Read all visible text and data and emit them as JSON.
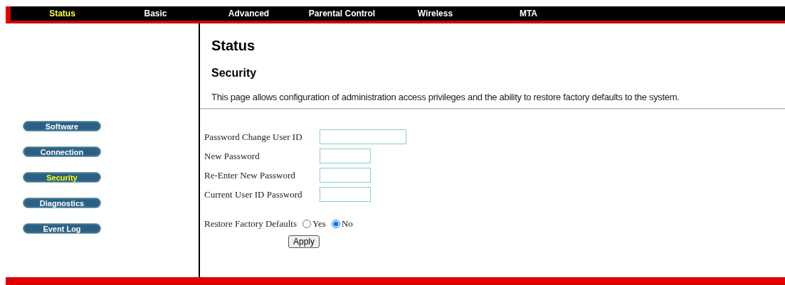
{
  "top_nav": [
    {
      "label": "Status",
      "selected": true
    },
    {
      "label": "Basic",
      "selected": false
    },
    {
      "label": "Advanced",
      "selected": false
    },
    {
      "label": "Parental Control",
      "selected": false
    },
    {
      "label": "Wireless",
      "selected": false
    },
    {
      "label": "MTA",
      "selected": false
    }
  ],
  "sidebar": [
    {
      "label": "Software",
      "selected": false
    },
    {
      "label": "Connection",
      "selected": false
    },
    {
      "label": "Security",
      "selected": true
    },
    {
      "label": "Diagnostics",
      "selected": false
    },
    {
      "label": "Event Log",
      "selected": false
    }
  ],
  "page_title": "Status",
  "section_title": "Security",
  "description": "This page allows configuration of administration access privileges and the ability to restore factory defaults to the system.",
  "fields": [
    {
      "label": "Password Change User ID",
      "kind": "wide"
    },
    {
      "label": "New Password",
      "kind": "short"
    },
    {
      "label": "Re-Enter New Password",
      "kind": "short"
    },
    {
      "label": "Current User ID Password",
      "kind": "short"
    }
  ],
  "restore": {
    "label": "Restore Factory Defaults",
    "options": [
      {
        "label": "Yes",
        "selected": false
      },
      {
        "label": "No",
        "selected": true
      }
    ]
  },
  "apply_button": "Apply"
}
